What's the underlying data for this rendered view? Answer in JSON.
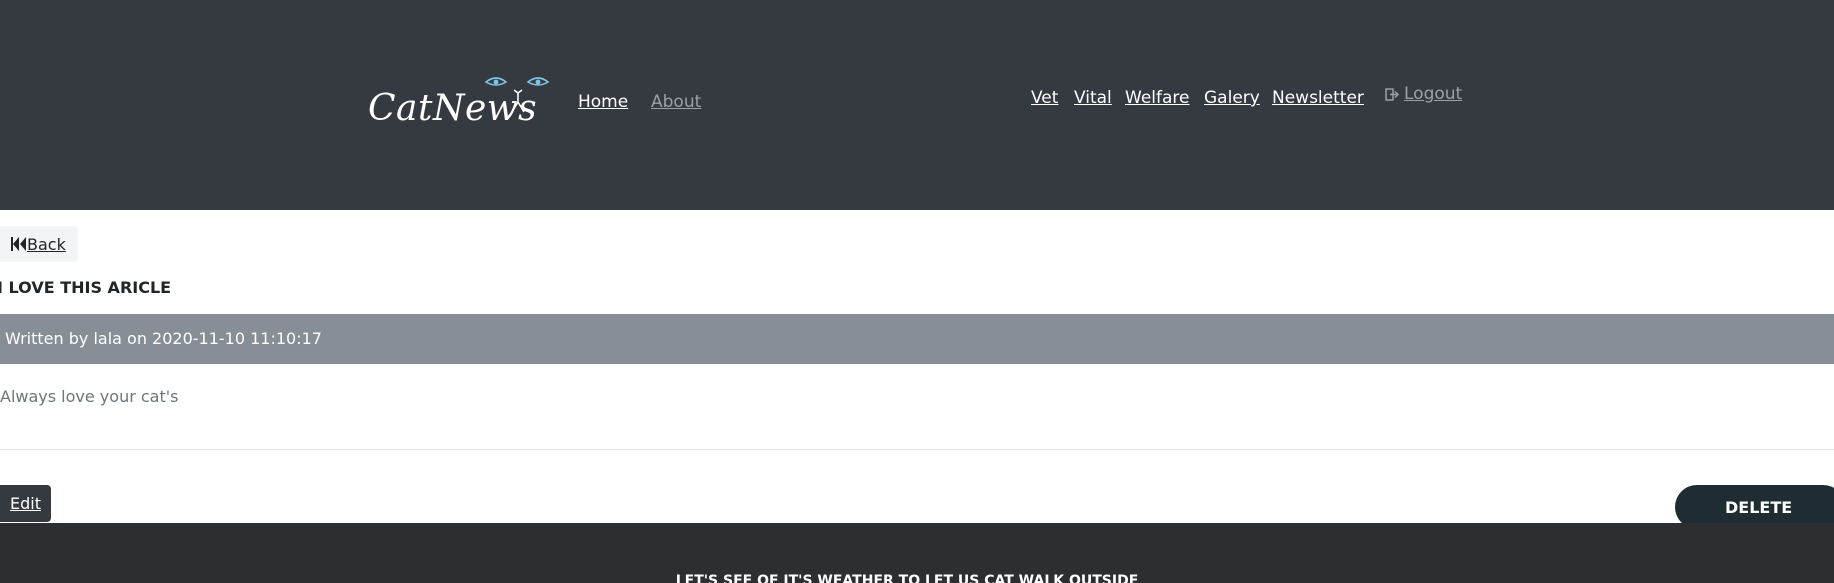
{
  "header": {
    "logo_text": "CatNews",
    "nav_left": [
      {
        "label": "Home"
      },
      {
        "label": "About"
      }
    ],
    "nav_right": [
      {
        "label": "Vet"
      },
      {
        "label": "Vital"
      },
      {
        "label": "Welfare"
      },
      {
        "label": "Galery"
      },
      {
        "label": "Newsletter"
      }
    ],
    "logout_label": "Logout"
  },
  "article": {
    "back_label": "Back",
    "title": "I LOVE THIS ARICLE",
    "byline": "Written by lala on 2020-11-10 11:10:17",
    "body": "Always love your cat's"
  },
  "actions": {
    "edit_label": "Edit",
    "delete_label": "DELETE"
  },
  "footer": {
    "text": "LET'S SEE OF IT'S WEATHER TO LET US CAT WALK OUTSIDE"
  },
  "colors": {
    "header_bg": "#343a40",
    "byline_bg": "#878e96",
    "footer_bg": "#2b2f32",
    "delete_bg": "#1f2d33",
    "eye_color": "#7ec3e6"
  },
  "icons": {
    "logo_eyes": "cat-eyes-icon",
    "logout": "sign-out-icon",
    "back": "fast-backward-icon"
  }
}
